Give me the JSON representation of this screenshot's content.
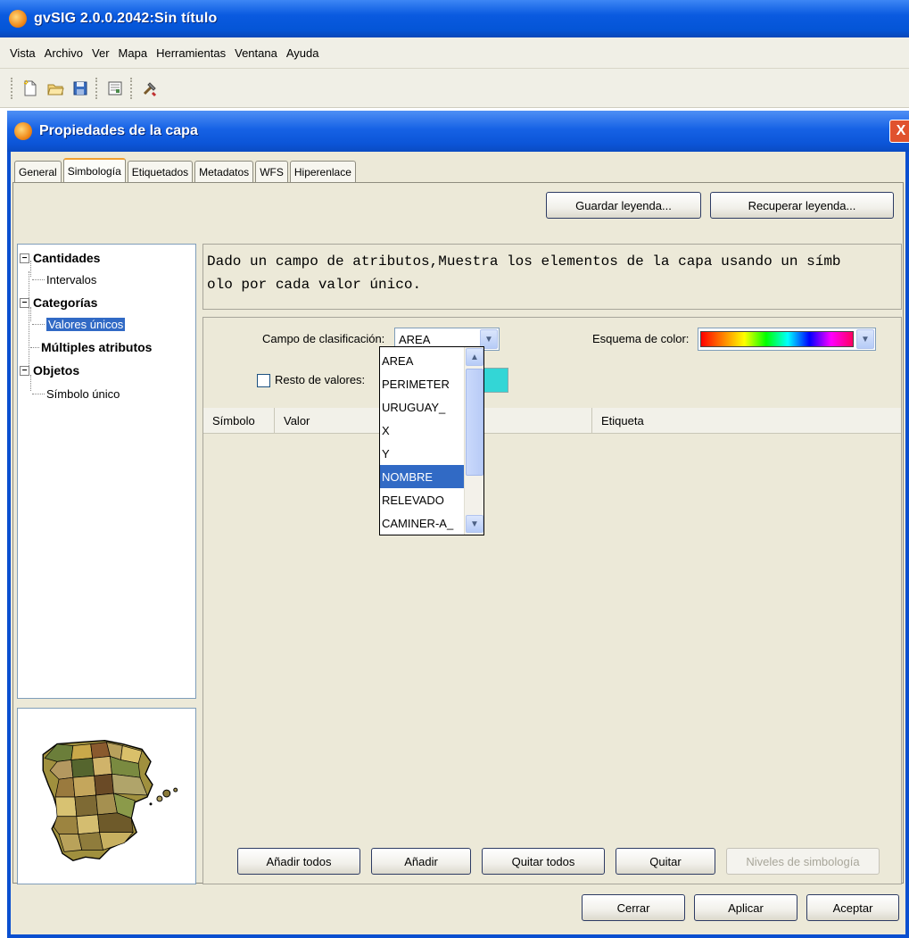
{
  "app": {
    "title": "gvSIG 2.0.0.2042:Sin título"
  },
  "menubar": {
    "items": [
      "Vista",
      "Archivo",
      "Ver",
      "Mapa",
      "Herramientas",
      "Ventana",
      "Ayuda"
    ]
  },
  "toolbar": {
    "icons": [
      "new-file-icon",
      "open-folder-icon",
      "save-icon",
      "layout-icon",
      "tools-icon"
    ]
  },
  "dialog": {
    "title": "Propiedades de la capa",
    "close_label": "X",
    "tabs": [
      "General",
      "Simbología",
      "Etiquetados",
      "Metadatos",
      "WFS",
      "Hiperenlace"
    ],
    "active_tab": "Simbología",
    "buttons": {
      "save_legend": "Guardar leyenda...",
      "load_legend": "Recuperar leyenda..."
    },
    "tree": {
      "cantidades": "Cantidades",
      "intervalos": "Intervalos",
      "categorias": "Categorías",
      "valores_unicos": "Valores únicos",
      "multiples": "Múltiples atributos",
      "objetos": "Objetos",
      "simbolo_unico": "Símbolo único"
    },
    "description": "Dado un campo de atributos,Muestra los elementos de la capa usando un símbolo por cada valor único.",
    "description_line1": "Dado un campo de atributos,Muestra los elementos de la capa usando un símb",
    "description_line2": "olo por cada valor único.",
    "classification": {
      "label": "Campo de clasificación:",
      "value": "AREA",
      "options": [
        "AREA",
        "PERIMETER",
        "URUGUAY_",
        "X",
        "Y",
        "NOMBRE",
        "RELEVADO",
        "CAMINER-A_"
      ],
      "highlighted": "NOMBRE"
    },
    "color_scheme": {
      "label": "Esquema de color:"
    },
    "rest_values": {
      "label": "Resto de valores:",
      "checked": false,
      "color": "#33d6d6"
    },
    "table": {
      "columns": [
        "Símbolo",
        "Valor",
        "Etiqueta"
      ],
      "rows": []
    },
    "actions": {
      "add_all": "Añadir todos",
      "add": "Añadir",
      "remove_all": "Quitar todos",
      "remove": "Quitar",
      "levels": "Niveles de simbología"
    },
    "footer": {
      "close": "Cerrar",
      "apply": "Aplicar",
      "accept": "Aceptar"
    }
  },
  "colors": {
    "title_bar": "#0455d6",
    "panel": "#ece9d8",
    "selection": "#316ac5",
    "close_button": "#e0522e"
  }
}
